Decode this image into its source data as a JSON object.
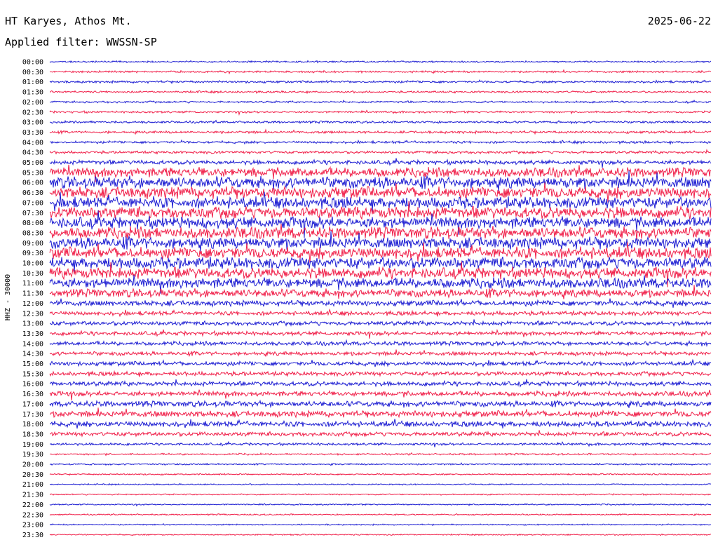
{
  "header": {
    "station": "HT Karyes, Athos Mt.",
    "filter": "Applied filter: WWSSN-SP",
    "date": "2025-06-22"
  },
  "chart_data": {
    "type": "line",
    "title": "HT Karyes, Athos Mt.",
    "ylabel": "HHZ - 30000",
    "xlabel": "",
    "colors": {
      "even": "#1e1ed2",
      "odd": "#f0204a"
    },
    "rows": [
      {
        "label": "00:00",
        "level": 0.1
      },
      {
        "label": "00:30",
        "level": 0.12
      },
      {
        "label": "01:00",
        "level": 0.14
      },
      {
        "label": "01:30",
        "level": 0.12
      },
      {
        "label": "02:00",
        "level": 0.12
      },
      {
        "label": "02:30",
        "level": 0.12
      },
      {
        "label": "03:00",
        "level": 0.14
      },
      {
        "label": "03:30",
        "level": 0.16
      },
      {
        "label": "04:00",
        "level": 0.16
      },
      {
        "label": "04:30",
        "level": 0.18
      },
      {
        "label": "05:00",
        "level": 0.3
      },
      {
        "label": "05:30",
        "level": 0.7
      },
      {
        "label": "06:00",
        "level": 0.85
      },
      {
        "label": "06:30",
        "level": 0.85
      },
      {
        "label": "07:00",
        "level": 0.85
      },
      {
        "label": "07:30",
        "level": 0.85
      },
      {
        "label": "08:00",
        "level": 0.85
      },
      {
        "label": "08:30",
        "level": 0.85
      },
      {
        "label": "09:00",
        "level": 0.85
      },
      {
        "label": "09:30",
        "level": 0.85
      },
      {
        "label": "10:00",
        "level": 0.85
      },
      {
        "label": "10:30",
        "level": 0.8
      },
      {
        "label": "11:00",
        "level": 0.75
      },
      {
        "label": "11:30",
        "level": 0.6
      },
      {
        "label": "12:00",
        "level": 0.4
      },
      {
        "label": "12:30",
        "level": 0.3
      },
      {
        "label": "13:00",
        "level": 0.3
      },
      {
        "label": "13:30",
        "level": 0.28
      },
      {
        "label": "14:00",
        "level": 0.28
      },
      {
        "label": "14:30",
        "level": 0.28
      },
      {
        "label": "15:00",
        "level": 0.3
      },
      {
        "label": "15:30",
        "level": 0.3
      },
      {
        "label": "16:00",
        "level": 0.32
      },
      {
        "label": "16:30",
        "level": 0.36
      },
      {
        "label": "17:00",
        "level": 0.4
      },
      {
        "label": "17:30",
        "level": 0.45
      },
      {
        "label": "18:00",
        "level": 0.4
      },
      {
        "label": "18:30",
        "level": 0.3
      },
      {
        "label": "19:00",
        "level": 0.16
      },
      {
        "label": "19:30",
        "level": 0.1
      },
      {
        "label": "20:00",
        "level": 0.08
      },
      {
        "label": "20:30",
        "level": 0.07
      },
      {
        "label": "21:00",
        "level": 0.06
      },
      {
        "label": "21:30",
        "level": 0.06
      },
      {
        "label": "22:00",
        "level": 0.06
      },
      {
        "label": "22:30",
        "level": 0.06
      },
      {
        "label": "23:00",
        "level": 0.06
      },
      {
        "label": "23:30",
        "level": 0.06
      }
    ]
  }
}
